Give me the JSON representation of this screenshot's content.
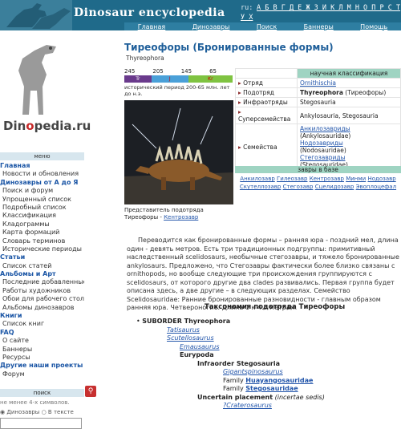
{
  "header": {
    "site_title": "Dinosaur encyclopedia",
    "alphabet_ru": "А Б В Г Д Е Ж З И К Л М Н О П Р С Т У Х",
    "alphabet_en": "A B C D E F G H I J K L M N O P Q R S T U",
    "lang_ru": "ru:",
    "lang_en": "en:"
  },
  "nav": [
    "Главная",
    "Динозавры",
    "Поиск",
    "Баннеры",
    "Помощь"
  ],
  "logo": {
    "pre": "Din",
    "o": "o",
    "post": "pedia.ru"
  },
  "sidebar": {
    "menu_header": "меню",
    "items": [
      {
        "label": "Главная",
        "type": "sec"
      },
      {
        "label": "Новости и обновления",
        "type": "item"
      },
      {
        "label": "Динозавры от А до Я",
        "type": "sec"
      },
      {
        "label": "Поиск и форум",
        "type": "item"
      },
      {
        "label": "Упрощенный список",
        "type": "item"
      },
      {
        "label": "Подробный список",
        "type": "item"
      },
      {
        "label": "Классификация",
        "type": "item"
      },
      {
        "label": "Кладограммы",
        "type": "item"
      },
      {
        "label": "Карта формаций",
        "type": "item"
      },
      {
        "label": "Словарь терминов",
        "type": "item"
      },
      {
        "label": "Исторические периоды",
        "type": "item"
      },
      {
        "label": "Статьи",
        "type": "sec"
      },
      {
        "label": "Список статей",
        "type": "item"
      },
      {
        "label": "Альбомы и Арт",
        "type": "sec"
      },
      {
        "label": "Последние добавленные",
        "type": "item"
      },
      {
        "label": "Работы художников",
        "type": "item"
      },
      {
        "label": "Обои для рабочего стола",
        "type": "item"
      },
      {
        "label": "Альбомы динозавров",
        "type": "item"
      },
      {
        "label": "Книги",
        "type": "sec"
      },
      {
        "label": "Список книг",
        "type": "item"
      },
      {
        "label": "FAQ",
        "type": "sec"
      },
      {
        "label": "О сайте",
        "type": "item"
      },
      {
        "label": "Баннеры",
        "type": "item"
      },
      {
        "label": "Ресурсы",
        "type": "item"
      },
      {
        "label": "Другие наши проекты",
        "type": "sec"
      },
      {
        "label": "Форум",
        "type": "item"
      }
    ],
    "search_header": "поиск",
    "search_note": "не менее 4-х символов.",
    "radio_1": "Динозавры",
    "radio_2": "В тексте"
  },
  "page": {
    "title": "Тиреофоры (Бронированные формы)",
    "latin": "Thyreophora",
    "timeline_nums": [
      "245",
      "205",
      "145",
      "65"
    ],
    "timeline_labels": [
      "Tr",
      "J",
      "Kr"
    ],
    "timeline_colors": [
      "#6a3a8c",
      "#4aa0d8",
      "#7fc341"
    ],
    "period_note": "исторический период 200-65 млн. лет до н.э.",
    "caption_text": "Представитель подотряда Тиреофоры - ",
    "caption_link": "Кентрозавр"
  },
  "classification": {
    "header": "научная классификация",
    "rows": [
      {
        "key": "Отряд",
        "val": "Ornithischia",
        "link": true
      },
      {
        "key": "Подотряд",
        "val": "Thyreophora",
        "extra": " (Тиреофоры)",
        "bold": true
      },
      {
        "key": "Инфраотряды",
        "val": "Stegosauria"
      },
      {
        "key": "Суперсемейства",
        "val": "Ankylosauria, Stegosauria"
      },
      {
        "key": "Семейства",
        "family_lines": [
          "Анкилозавриды",
          "(Ankylosauridae)",
          "Нодозавриды",
          "(Nodosauridae)",
          "Стегозавриды",
          "(Stegosauridae)"
        ]
      }
    ],
    "genera_header": "завры в базе",
    "genera": [
      "Анкилозавр",
      "Гилеозавр",
      "Кентрозавр",
      "Минми",
      "Нодозавр",
      "Скутеллозавр",
      "Стегозавр",
      "Сцелидозавр",
      "Эвоплоцефал"
    ]
  },
  "article": {
    "paragraph": "Переводится как бронированные формы – ранняя юра - поздний мел, длина один - девять метров. Есть три традиционных подгруппы: примитивный наследственный scelidosaurs, необычные стегозавры, и тяжело бронированные ankylosaurs. Предложено, что Стегозавры фактически более близко связаны с ornithopods, но вообще следующие три происхождения группируются с scelidosaurs, от которого другие два clades развивались. Первая группа будет описана здесь, а две другие – в следующих разделах. Семейство Scelidosauridae: Ранние бронированные разновидности - главным образом ранняя юра. Четвероногие. Длина 1 к 4.5 метрам.",
    "tax_title": "Таксономия подотряда Тиреофоры",
    "suborder": "SUBORDER Thyreophora",
    "tatisaurus": "Tatisaurus",
    "scutellosaurus": "Scutellosaurus",
    "emausaurus": "Emausaurus",
    "eurypoda": "Eurypoda",
    "infraorder": "Infraorder Stegosauria",
    "gigantspinosaurus": "Gigantspinosaurus",
    "family_1": "Huayangosauridae",
    "family_2": "Stegosauridae",
    "family_word": "Family ",
    "uncertain": "Uncertain placement",
    "incertae": " (incertae sedis)",
    "cratero": "?Craterosaurus"
  }
}
